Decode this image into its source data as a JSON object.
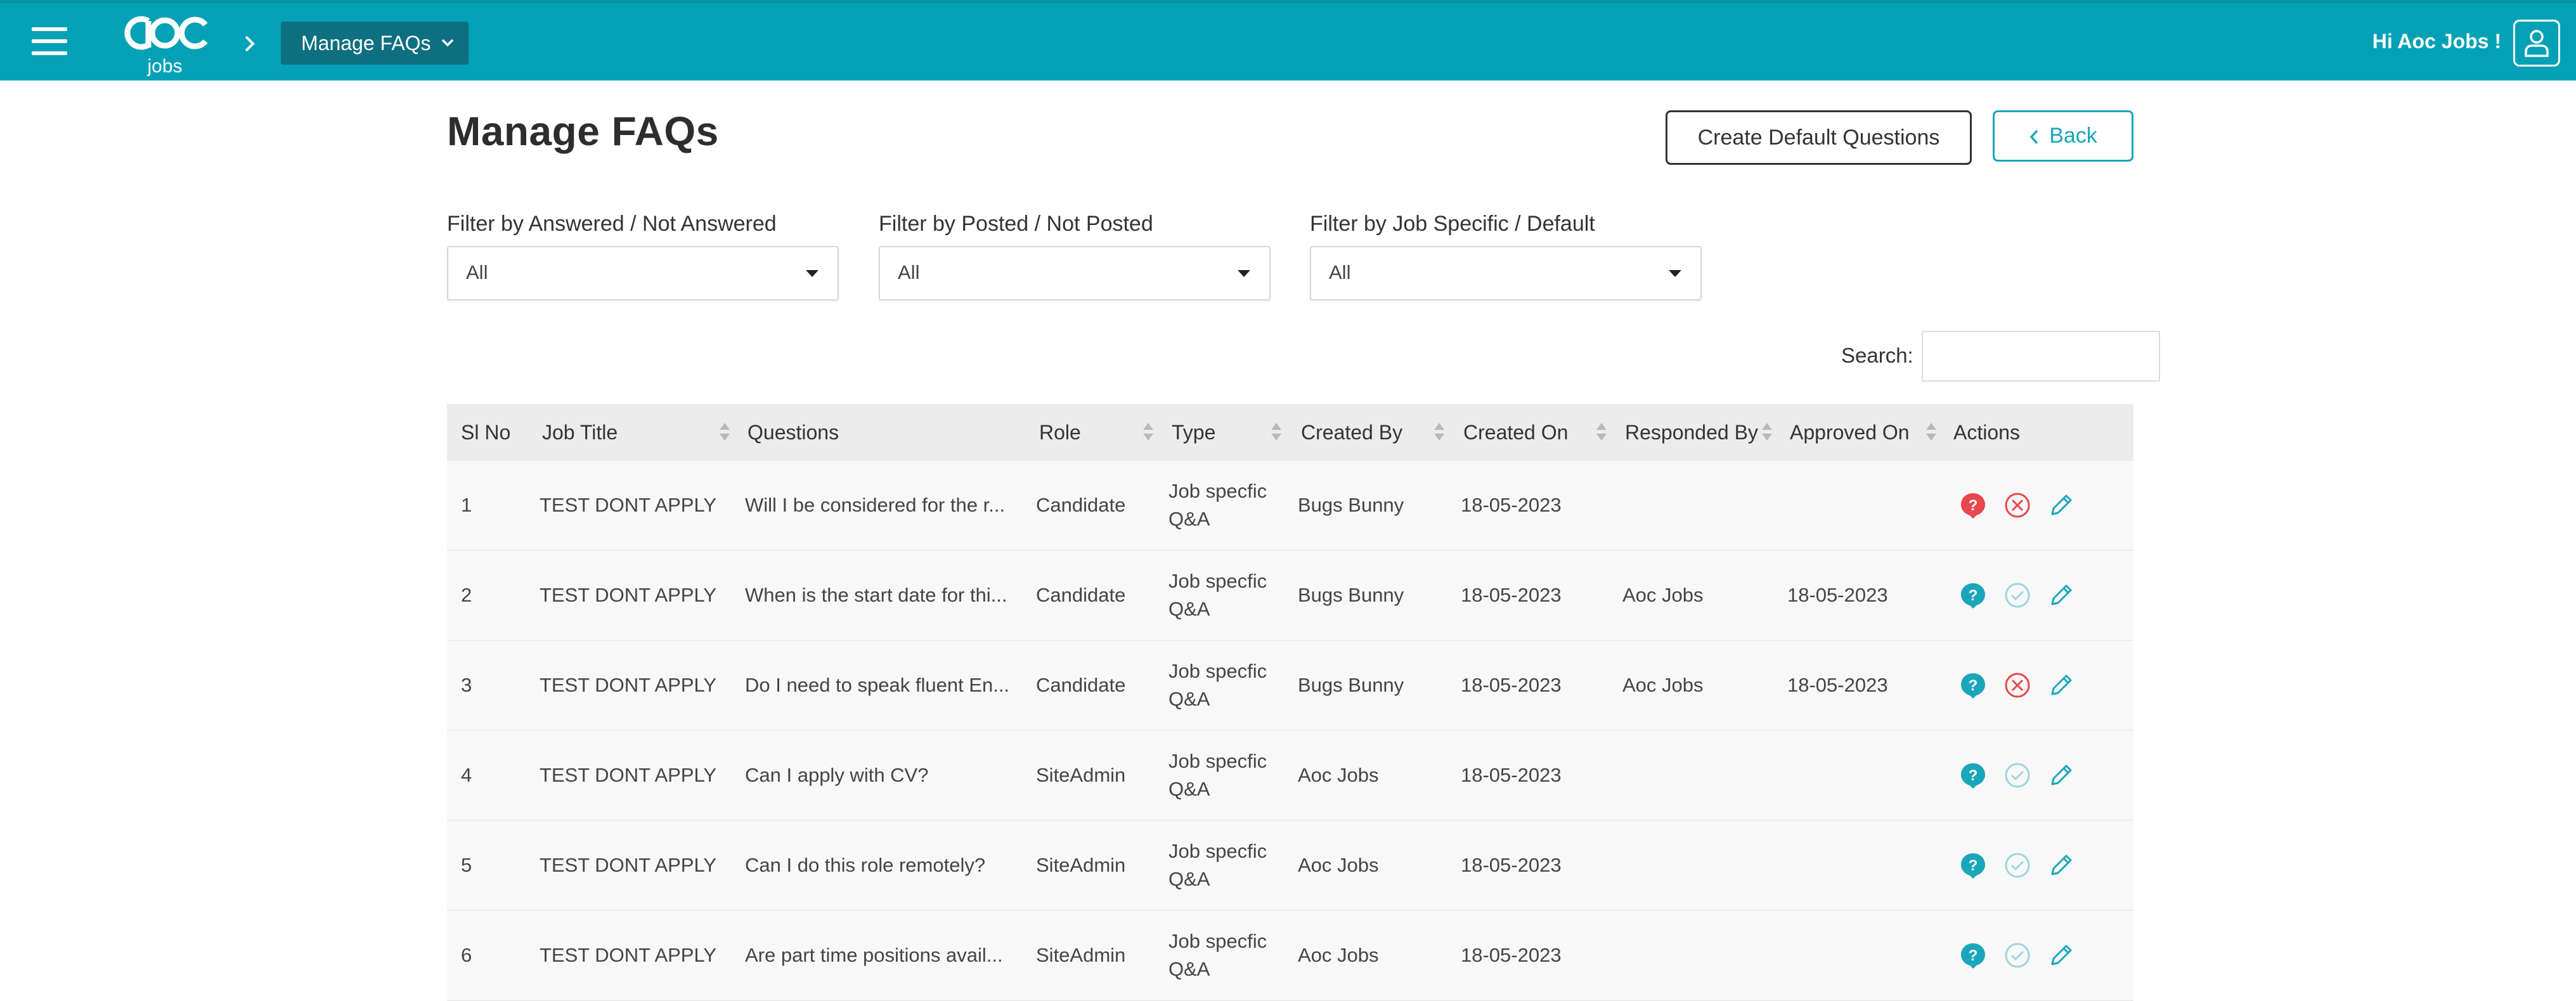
{
  "header": {
    "logo_text": "aoc",
    "logo_subtext": "jobs",
    "breadcrumb": "Manage FAQs",
    "greeting": "Hi Aoc Jobs !"
  },
  "page": {
    "title": "Manage FAQs",
    "create_default_label": "Create Default Questions",
    "back_label": "Back"
  },
  "filters": [
    {
      "label": "Filter by Answered / Not Answered",
      "value": "All"
    },
    {
      "label": "Filter by Posted / Not Posted",
      "value": "All"
    },
    {
      "label": "Filter by Job Specific / Default",
      "value": "All"
    }
  ],
  "search": {
    "label": "Search:",
    "value": ""
  },
  "table": {
    "columns": [
      "Sl No",
      "Job Title",
      "Questions",
      "Role",
      "Type",
      "Created By",
      "Created On",
      "Responded By",
      "Approved On",
      "Actions"
    ],
    "rows": [
      {
        "sl": "1",
        "job": "TEST DONT APPLY",
        "question": "Will I be considered for the r...",
        "role": "Candidate",
        "type": "Job specfic Q&A",
        "created_by": "Bugs Bunny",
        "created_on": "18-05-2023",
        "responded_by": "",
        "approved_on": "",
        "q_icon": "red",
        "status_icon": "rejected"
      },
      {
        "sl": "2",
        "job": "TEST DONT APPLY",
        "question": "When is the start date for thi...",
        "role": "Candidate",
        "type": "Job specfic Q&A",
        "created_by": "Bugs Bunny",
        "created_on": "18-05-2023",
        "responded_by": "Aoc Jobs",
        "approved_on": "18-05-2023",
        "q_icon": "teal",
        "status_icon": "approved"
      },
      {
        "sl": "3",
        "job": "TEST DONT APPLY",
        "question": "Do I need to speak fluent En...",
        "role": "Candidate",
        "type": "Job specfic Q&A",
        "created_by": "Bugs Bunny",
        "created_on": "18-05-2023",
        "responded_by": "Aoc Jobs",
        "approved_on": "18-05-2023",
        "q_icon": "teal",
        "status_icon": "rejected"
      },
      {
        "sl": "4",
        "job": "TEST DONT APPLY",
        "question": "Can I apply with CV?",
        "role": "SiteAdmin",
        "type": "Job specfic Q&A",
        "created_by": "Aoc Jobs",
        "created_on": "18-05-2023",
        "responded_by": "",
        "approved_on": "",
        "q_icon": "teal",
        "status_icon": "approved"
      },
      {
        "sl": "5",
        "job": "TEST DONT APPLY",
        "question": "Can I do this role remotely?",
        "role": "SiteAdmin",
        "type": "Job specfic Q&A",
        "created_by": "Aoc Jobs",
        "created_on": "18-05-2023",
        "responded_by": "",
        "approved_on": "",
        "q_icon": "teal",
        "status_icon": "approved"
      },
      {
        "sl": "6",
        "job": "TEST DONT APPLY",
        "question": "Are part time positions avail...",
        "role": "SiteAdmin",
        "type": "Job specfic Q&A",
        "created_by": "Aoc Jobs",
        "created_on": "18-05-2023",
        "responded_by": "",
        "approved_on": "",
        "q_icon": "teal",
        "status_icon": "approved"
      }
    ]
  },
  "colors": {
    "brand": "#03a1b6",
    "breadcrumb_bg": "#0d6f80",
    "icon_teal": "#1aa6ba",
    "icon_red": "#e8474b",
    "icon_pale_teal": "#9dd6de"
  }
}
